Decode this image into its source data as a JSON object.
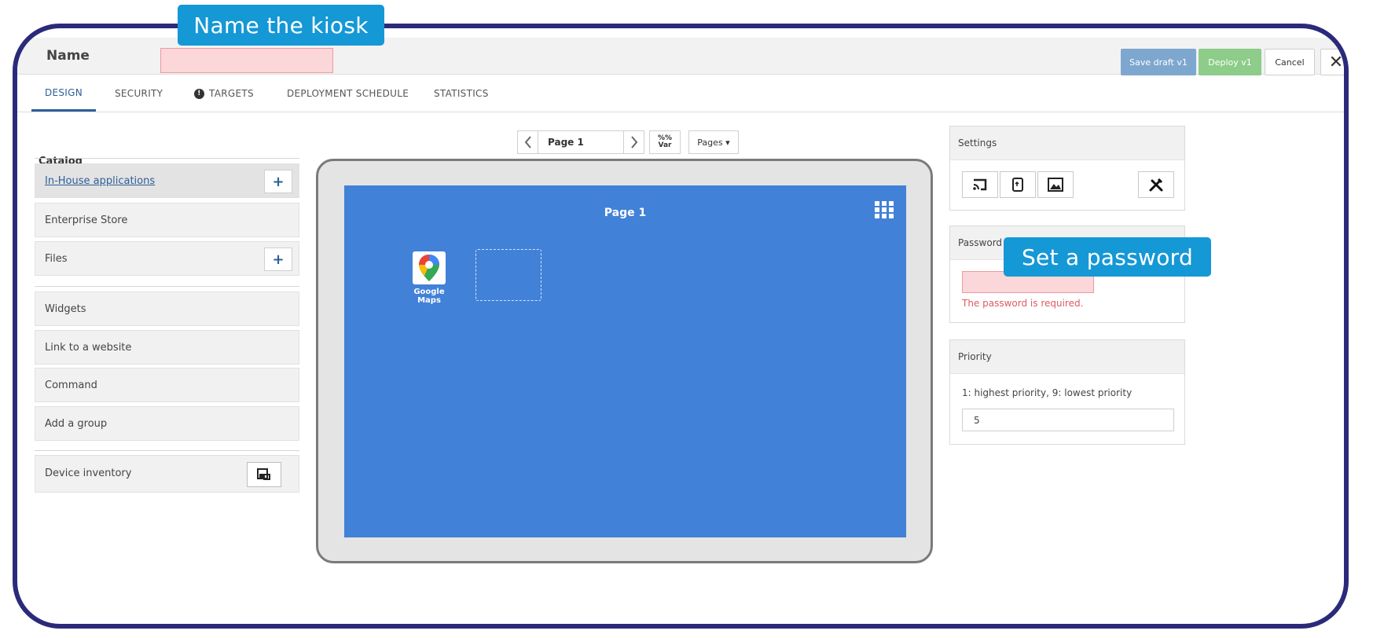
{
  "header": {
    "name_label": "Name",
    "name_value": "",
    "buttons": {
      "save_draft": "Save draft v1",
      "deploy": "Deploy v1",
      "cancel": "Cancel",
      "close": "✕"
    }
  },
  "tabs": [
    {
      "label": "DESIGN",
      "active": true
    },
    {
      "label": "SECURITY"
    },
    {
      "label": "TARGETS",
      "icon": "alert-icon"
    },
    {
      "label": "DEPLOYMENT SCHEDULE"
    },
    {
      "label": "STATISTICS"
    }
  ],
  "catalog": {
    "title": "Catalog",
    "items": [
      {
        "label": "In-House applications",
        "selected": true,
        "action": "plus-icon"
      },
      {
        "label": "Enterprise Store"
      },
      {
        "label": "Files",
        "action": "plus-icon"
      },
      {
        "label": "Widgets"
      },
      {
        "label": "Link to a website"
      },
      {
        "label": "Command"
      },
      {
        "label": "Add a group"
      },
      {
        "label": "Device inventory",
        "action": "device-inventory-icon"
      }
    ],
    "plus_symbol": "+"
  },
  "pager": {
    "current_page": "Page 1",
    "var_button": "%%\nVar",
    "pages_button": "Pages ▾"
  },
  "preview": {
    "page_title": "Page 1",
    "app_tile": {
      "label": "Google Maps",
      "icon": "google-maps-icon"
    },
    "background_color": "#4281d8"
  },
  "settings": {
    "title": "Settings"
  },
  "password": {
    "title": "Password",
    "value": "",
    "error": "The password is required."
  },
  "priority": {
    "title": "Priority",
    "help": "1: highest priority, 9: lowest priority",
    "value": "5"
  },
  "callouts": {
    "name": "Name the  kiosk",
    "password": "Set  a password"
  },
  "colors": {
    "frame": "#2b2a7a",
    "callout": "#1598d6",
    "accent": "#2c5f98",
    "save_draft": "#7ea7cf",
    "deploy": "#8dcc89",
    "error": "#e05a63"
  }
}
